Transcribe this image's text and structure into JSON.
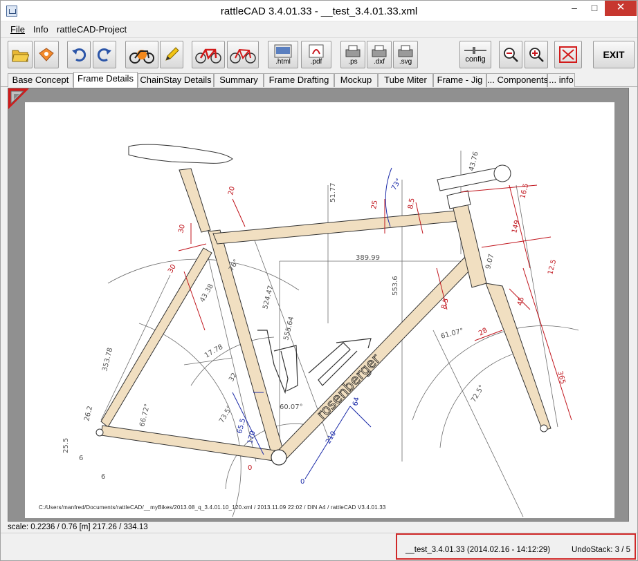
{
  "window": {
    "title": "rattleCAD  3.4.01.33 - __test_3.4.01.33.xml",
    "min_glyph": "–",
    "max_glyph": "□",
    "close_glyph": "✕"
  },
  "menu": {
    "items": [
      "File",
      "Info",
      "rattleCAD-Project"
    ]
  },
  "toolbar": {
    "html_label": ".html",
    "pdf_label": ".pdf",
    "ps_label": ".ps",
    "dxf_label": ".dxf",
    "svg_label": ".svg",
    "config_label": "config",
    "exit_label": "EXIT"
  },
  "tabs": [
    "Base Concept",
    "Frame Details",
    "ChainStay Details",
    "Summary",
    "Frame Drafting",
    "Mockup",
    "Tube Miter",
    "Frame - Jig",
    "... Components",
    "... info"
  ],
  "active_tab": "Frame Details",
  "drawing": {
    "brand_text": "rosenberger",
    "dims": {
      "d1": "20",
      "d2": "30",
      "d3": "30",
      "d4": "43.38",
      "d5": "76°",
      "d6": "524.47",
      "d7": "555.64",
      "d8": "389.99",
      "d9": "553.6",
      "d10": "51.77",
      "d11": "25",
      "d12": "73°",
      "d13": "8.5",
      "d14": "43.76",
      "d15": "16.5",
      "d16": "149",
      "d17": "9.07",
      "d18": "12.5",
      "d19": "45",
      "d20": "8.5",
      "d21": "28",
      "d22": "61.07°",
      "d23": "365",
      "d24": "72.5°",
      "d25": "353.78",
      "d26": "17.78",
      "d27": "60.07°",
      "d28": "66.72°",
      "d29": "26.2",
      "d30": "25.5",
      "d31": "6",
      "d32": "6",
      "d33": "73.5°",
      "d34": "65.5",
      "d35": "170",
      "d36": "64",
      "d37": "210",
      "d38": "0",
      "d39": "0",
      "d40": "32"
    },
    "footer_stamp": "C:/Users/manfred/Documents/rattleCAD/__myBikes/2013.08_q_3.4.01.10_120.xml   /   2013.11.09  22:02   /  DIN A4 /   rattleCAD   V3.4.01.33"
  },
  "scale_text": "scale: 0.2236 / 0.76  [m]  217.26 / 334.13",
  "status": {
    "file_text": "__test_3.4.01.33 (2014.02.16 - 14:12:29)",
    "undo_text": "UndoStack:  3 / 5"
  },
  "colors": {
    "tube_fill": "#f1dfc1",
    "dim_red": "#c0141c",
    "dim_blue": "#1a2aa8",
    "dim_gray": "#6c6c6c",
    "status_border": "#d02828"
  }
}
